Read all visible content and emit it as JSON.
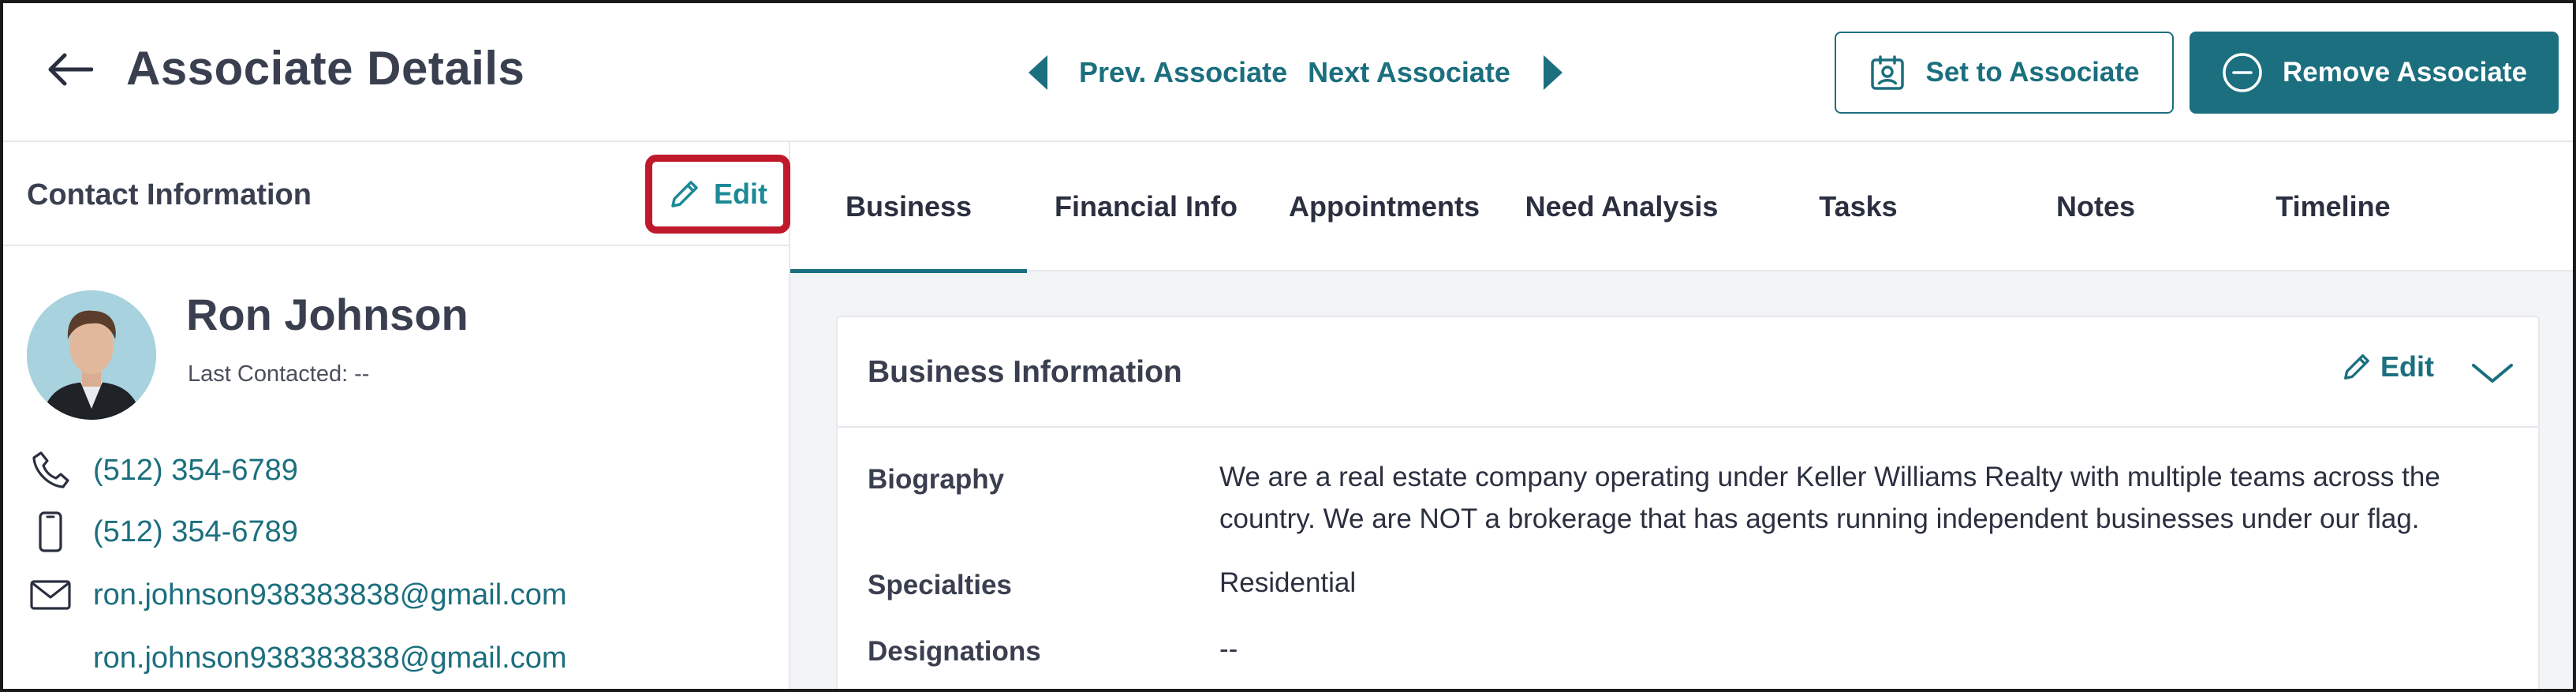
{
  "header": {
    "title": "Associate Details",
    "prev_label": "Prev. Associate",
    "next_label": "Next Associate",
    "set_label": "Set to Associate",
    "remove_label": "Remove Associate"
  },
  "contact": {
    "section_title": "Contact Information",
    "edit_label": "Edit",
    "name": "Ron Johnson",
    "last_contacted_label": "Last Contacted:",
    "last_contacted_value": "--",
    "phone_1": "(512) 354-6789",
    "phone_2": "(512) 354-6789",
    "email_1": "ron.johnson938383838@gmail.com",
    "email_2": "ron.johnson938383838@gmail.com"
  },
  "tabs": [
    {
      "label": "Business",
      "active": true
    },
    {
      "label": "Financial Info",
      "active": false
    },
    {
      "label": "Appointments",
      "active": false
    },
    {
      "label": "Need Analysis",
      "active": false
    },
    {
      "label": "Tasks",
      "active": false
    },
    {
      "label": "Notes",
      "active": false
    },
    {
      "label": "Timeline",
      "active": false
    }
  ],
  "business": {
    "title": "Business Information",
    "edit_label": "Edit",
    "fields": [
      {
        "label": "Biography",
        "value": "We are a real estate company operating under Keller Williams Realty with multiple teams across the country. We are NOT a brokerage that has agents running independent businesses under our flag."
      },
      {
        "label": "Specialties",
        "value": "Residential"
      },
      {
        "label": "Designations",
        "value": "--"
      }
    ]
  },
  "colors": {
    "accent": "#1b6f7e",
    "highlight": "#c0192b"
  },
  "icons": [
    "back-arrow-icon",
    "chevron-left-icon",
    "chevron-right-icon",
    "contact-badge-icon",
    "minus-circle-icon",
    "pencil-icon",
    "phone-icon",
    "mobile-icon",
    "mail-icon",
    "chevron-down-icon"
  ]
}
